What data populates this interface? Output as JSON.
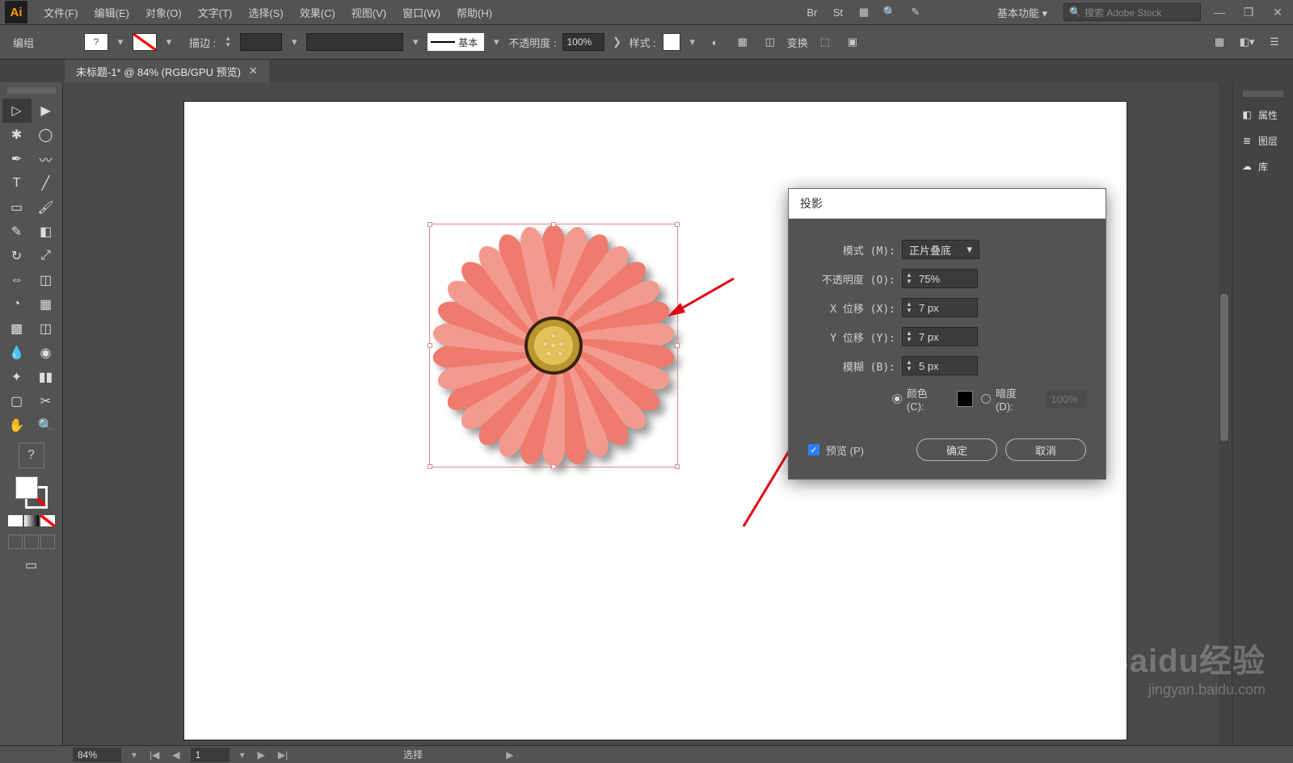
{
  "menubar": {
    "logo": "Ai",
    "items": [
      "文件(F)",
      "编辑(E)",
      "对象(O)",
      "文字(T)",
      "选择(S)",
      "效果(C)",
      "视图(V)",
      "窗口(W)",
      "帮助(H)"
    ],
    "workspace_label": "基本功能",
    "search_placeholder": "搜索 Adobe Stock"
  },
  "controlbar": {
    "group_label": "编组",
    "stroke_label": "描边 :",
    "stroke_basic": "基本",
    "opacity_label": "不透明度 :",
    "opacity_value": "100%",
    "style_label": "样式 :",
    "transform_label": "变换"
  },
  "document_tab": {
    "title": "未标题-1* @ 84% (RGB/GPU 预览)"
  },
  "dialog": {
    "title": "投影",
    "mode_label": "模式 (M):",
    "mode_value": "正片叠底",
    "opacity_label": "不透明度 (O):",
    "opacity_value": "75%",
    "x_offset_label": "X 位移 (X):",
    "x_offset_value": "7 px",
    "y_offset_label": "Y 位移 (Y):",
    "y_offset_value": "7 px",
    "blur_label": "模糊 (B):",
    "blur_value": "5 px",
    "color_label": "颜色 (C):",
    "dark_label": "暗度 (D):",
    "dark_value": "100%",
    "preview_label": "预览 (P)",
    "ok": "确定",
    "cancel": "取消"
  },
  "right_dock": {
    "attributes": "属性",
    "layers": "图层",
    "library": "库"
  },
  "statusbar": {
    "zoom": "84%",
    "page": "1",
    "select_label": "选择"
  },
  "watermark": {
    "big": "Baidu经验",
    "small": "jingyan.baidu.com"
  }
}
